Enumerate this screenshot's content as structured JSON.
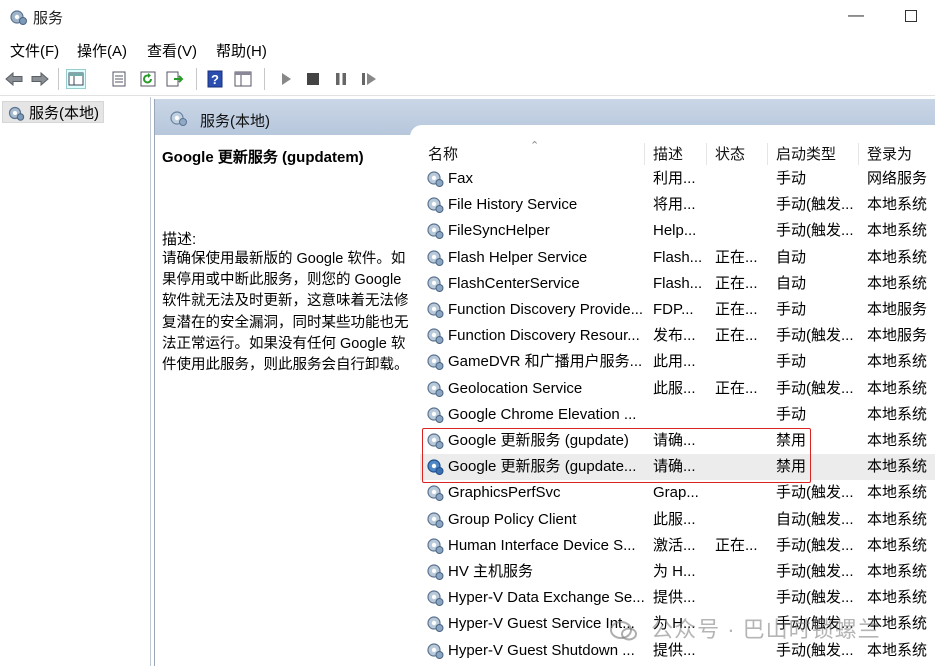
{
  "window": {
    "title": "服务",
    "minimize_glyph": "—"
  },
  "menu": [
    "文件(F)",
    "操作(A)",
    "查看(V)",
    "帮助(H)"
  ],
  "toolbar": {
    "icons": [
      "back-arrow-icon",
      "forward-arrow-icon",
      "console-tree-icon",
      "properties-icon",
      "refresh-icon",
      "export-list-icon",
      "help-icon",
      "view-icon",
      "play-icon",
      "stop-icon",
      "pause-icon",
      "restart-icon"
    ]
  },
  "tree": {
    "root_label": "服务(本地)"
  },
  "panel": {
    "header_label": "服务(本地)",
    "selected_title": "Google 更新服务 (gupdatem)",
    "desc_label": "描述:",
    "desc_text": "请确保使用最新版的 Google 软件。如果停用或中断此服务，则您的 Google 软件就无法及时更新，这意味着无法修复潜在的安全漏洞，同时某些功能也无法正常运行。如果没有任何 Google 软件使用此服务，则此服务会自行卸载。"
  },
  "list": {
    "columns": {
      "name": "名称",
      "desc": "描述",
      "status": "状态",
      "startup": "启动类型",
      "logon": "登录为"
    },
    "sort_glyph": "⌃",
    "rows": [
      {
        "name": "Fax",
        "desc": "利用...",
        "status": "",
        "startup": "手动",
        "logon": "网络服务"
      },
      {
        "name": "File History Service",
        "desc": "将用...",
        "status": "",
        "startup": "手动(触发...",
        "logon": "本地系统"
      },
      {
        "name": "FileSyncHelper",
        "desc": "Help...",
        "status": "",
        "startup": "手动(触发...",
        "logon": "本地系统"
      },
      {
        "name": "Flash Helper Service",
        "desc": "Flash...",
        "status": "正在...",
        "startup": "自动",
        "logon": "本地系统"
      },
      {
        "name": "FlashCenterService",
        "desc": "Flash...",
        "status": "正在...",
        "startup": "自动",
        "logon": "本地系统"
      },
      {
        "name": "Function Discovery Provide...",
        "desc": "FDP...",
        "status": "正在...",
        "startup": "手动",
        "logon": "本地服务"
      },
      {
        "name": "Function Discovery Resour...",
        "desc": "发布...",
        "status": "正在...",
        "startup": "手动(触发...",
        "logon": "本地服务"
      },
      {
        "name": "GameDVR 和广播用户服务...",
        "desc": "此用...",
        "status": "",
        "startup": "手动",
        "logon": "本地系统"
      },
      {
        "name": "Geolocation Service",
        "desc": "此服...",
        "status": "正在...",
        "startup": "手动(触发...",
        "logon": "本地系统"
      },
      {
        "name": "Google Chrome Elevation ...",
        "desc": "",
        "status": "",
        "startup": "手动",
        "logon": "本地系统"
      },
      {
        "name": "Google 更新服务 (gupdate)",
        "desc": "请确...",
        "status": "",
        "startup": "禁用",
        "logon": "本地系统"
      },
      {
        "name": "Google 更新服务 (gupdate...",
        "desc": "请确...",
        "status": "",
        "startup": "禁用",
        "logon": "本地系统"
      },
      {
        "name": "GraphicsPerfSvc",
        "desc": "Grap...",
        "status": "",
        "startup": "手动(触发...",
        "logon": "本地系统"
      },
      {
        "name": "Group Policy Client",
        "desc": "此服...",
        "status": "",
        "startup": "自动(触发...",
        "logon": "本地系统"
      },
      {
        "name": "Human Interface Device S...",
        "desc": "激活...",
        "status": "正在...",
        "startup": "手动(触发...",
        "logon": "本地系统"
      },
      {
        "name": "HV 主机服务",
        "desc": "为 H...",
        "status": "",
        "startup": "手动(触发...",
        "logon": "本地系统"
      },
      {
        "name": "Hyper-V Data Exchange Se...",
        "desc": "提供...",
        "status": "",
        "startup": "手动(触发...",
        "logon": "本地系统"
      },
      {
        "name": "Hyper-V Guest Service Int...",
        "desc": "为 H...",
        "status": "",
        "startup": "手动(触发...",
        "logon": "本地系统"
      },
      {
        "name": "Hyper-V Guest Shutdown ...",
        "desc": "提供...",
        "status": "",
        "startup": "手动(触发...",
        "logon": "本地系统"
      }
    ]
  },
  "watermark": "公众号 · 巴山时锁螺兰",
  "colors": {
    "highlight_border": "#dd2222",
    "header_gradient_top": "#c9d6e6",
    "header_gradient_bottom": "#b7c7dc",
    "selected_row": "#ececec"
  }
}
